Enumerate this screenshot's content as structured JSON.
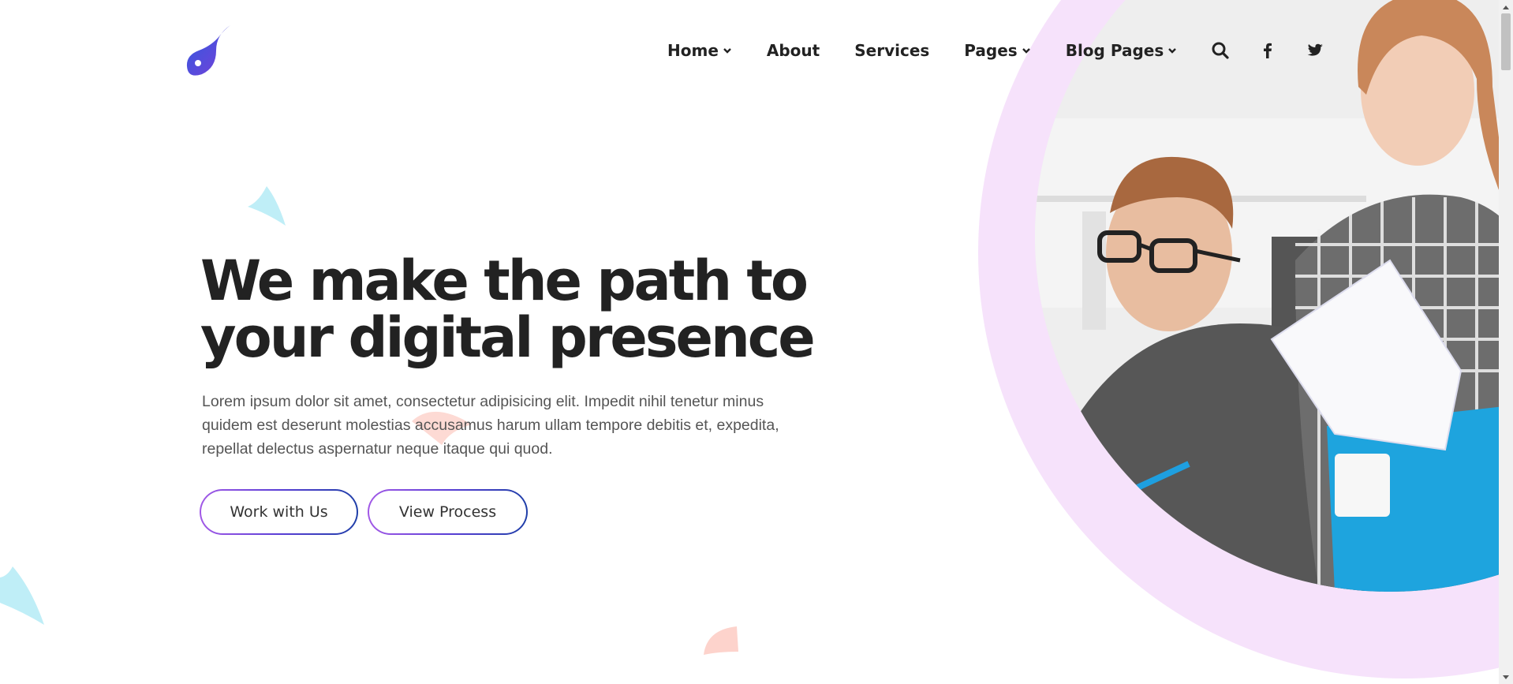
{
  "brand": {
    "logo_icon": "flame-drop-logo",
    "logo_color": "#5a36d6"
  },
  "nav": {
    "items": [
      {
        "label": "Home",
        "has_dropdown": true
      },
      {
        "label": "About",
        "has_dropdown": false
      },
      {
        "label": "Services",
        "has_dropdown": false
      },
      {
        "label": "Pages",
        "has_dropdown": true
      },
      {
        "label": "Blog Pages",
        "has_dropdown": true
      }
    ],
    "icons": [
      "search-icon",
      "facebook-icon",
      "twitter-icon"
    ]
  },
  "hero": {
    "title_line1": "We make the path to",
    "title_line2": "your digital presence",
    "description": "Lorem ipsum dolor sit amet, consectetur adipisicing elit. Impedit nihil tenetur minus quidem est deserunt molestias accusamus harum ullam tempore debitis et, expedita, repellat delectus aspernatur neque itaque qui quod.",
    "primary_button": "Work with Us",
    "secondary_button": "View Process"
  },
  "colors": {
    "accent_gradient_start": "#a259e6",
    "accent_gradient_end": "#1f3fa8",
    "circle_bg": "#f6e2fb",
    "deco_cyan": "#bfeef7",
    "deco_peach": "#fdd3cc",
    "title_text": "#222222"
  }
}
